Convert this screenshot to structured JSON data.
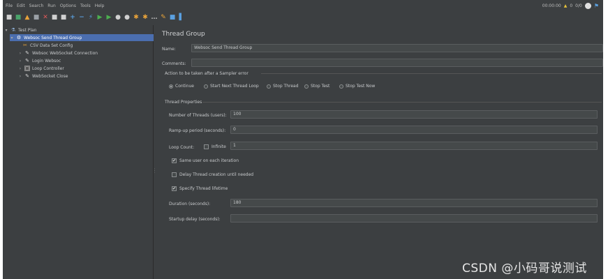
{
  "menu": [
    "File",
    "Edit",
    "Search",
    "Run",
    "Options",
    "Tools",
    "Help"
  ],
  "toolbar": {
    "icons": [
      {
        "name": "new-icon",
        "glyph": "■",
        "color": "#d0d0d0"
      },
      {
        "name": "templates-icon",
        "glyph": "■",
        "color": "#4aa36b"
      },
      {
        "name": "open-icon",
        "glyph": "▲",
        "color": "#e8a33a"
      },
      {
        "name": "save-icon",
        "glyph": "■",
        "color": "#9aa0a6"
      },
      {
        "name": "cut-icon",
        "glyph": "✕",
        "color": "#e05a5a"
      },
      {
        "name": "copy-icon",
        "glyph": "■",
        "color": "#d0d0d0"
      },
      {
        "name": "paste-icon",
        "glyph": "■",
        "color": "#d0d0d0"
      },
      {
        "name": "expand-icon",
        "glyph": "+",
        "color": "#5aa0e0"
      },
      {
        "name": "collapse-icon",
        "glyph": "−",
        "color": "#5aa0e0"
      },
      {
        "name": "toggle-icon",
        "glyph": "⚡",
        "color": "#5aa0e0"
      },
      {
        "name": "start-icon",
        "glyph": "▶",
        "color": "#4caf50"
      },
      {
        "name": "start-no-pause-icon",
        "glyph": "▶",
        "color": "#4caf50"
      },
      {
        "name": "stop-icon",
        "glyph": "●",
        "color": "#d0d0d0"
      },
      {
        "name": "shutdown-icon",
        "glyph": "●",
        "color": "#d0d0d0"
      },
      {
        "name": "remote-start-icon",
        "glyph": "✱",
        "color": "#e8a33a"
      },
      {
        "name": "clear-icon",
        "glyph": "✱",
        "color": "#e8a33a"
      },
      {
        "name": "clear-all-icon",
        "glyph": "…",
        "color": "#bbbbbb"
      },
      {
        "name": "search-icon",
        "glyph": "✎",
        "color": "#e8a33a"
      },
      {
        "name": "reset-search-icon",
        "glyph": "■",
        "color": "#5aa0e0"
      },
      {
        "name": "function-helper-icon",
        "glyph": "▌",
        "color": "#5aa0e0"
      }
    ],
    "timer": "00:00:00",
    "warning_count": "0",
    "threads_status": "0/0",
    "warning_color": "#e8c33a"
  },
  "tree": {
    "root": "Test Plan",
    "thread_group": "Websoc Send Thread Group",
    "children": [
      "CSV Data Set Config",
      "Websoc WebSocket Connection",
      "Login Websoc",
      "Loop Controller",
      "WebSocket Close"
    ]
  },
  "panel": {
    "title": "Thread Group",
    "name_label": "Name:",
    "name_value": "Websoc Send Thread Group",
    "comments_label": "Comments:",
    "comments_value": "",
    "error_action_label": "Action to be taken after a Sampler error",
    "error_actions": [
      "Continue",
      "Start Next Thread Loop",
      "Stop Thread",
      "Stop Test",
      "Stop Test Now"
    ],
    "selected_action_index": 0,
    "thread_properties_label": "Thread Properties",
    "threads_label": "Number of Threads (users):",
    "threads_value": "100",
    "rampup_label": "Ramp-up period (seconds):",
    "rampup_value": "0",
    "loop_label": "Loop Count:",
    "infinite_label": "Infinite",
    "infinite_checked": false,
    "loop_value": "1",
    "same_user_label": "Same user on each iteration",
    "same_user_checked": true,
    "delay_label": "Delay Thread creation until needed",
    "delay_checked": false,
    "lifetime_label": "Specify Thread lifetime",
    "lifetime_checked": true,
    "duration_label": "Duration (seconds):",
    "duration_value": "180",
    "startup_label": "Startup delay (seconds):",
    "startup_value": ""
  },
  "watermark": "CSDN @小码哥说测试"
}
